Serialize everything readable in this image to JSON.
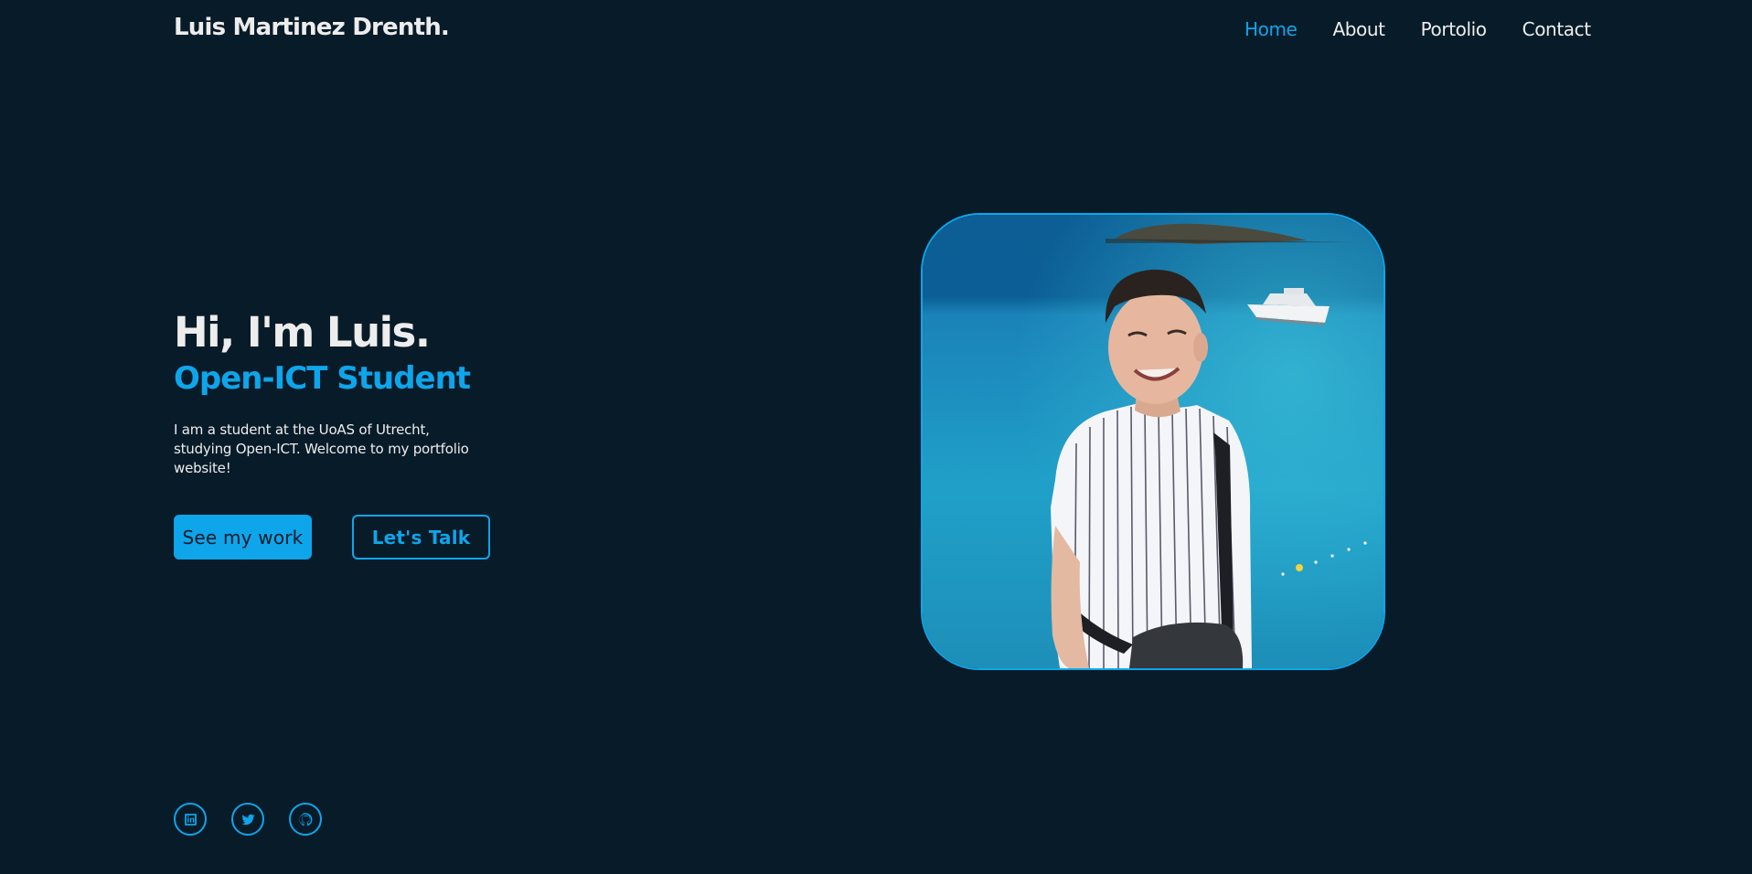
{
  "header": {
    "logo": "Luis Martinez Drenth.",
    "nav": [
      {
        "label": "Home",
        "active": true
      },
      {
        "label": "About",
        "active": false
      },
      {
        "label": "Portolio",
        "active": false
      },
      {
        "label": "Contact",
        "active": false
      }
    ]
  },
  "hero": {
    "greeting": "Hi, I'm Luis.",
    "role": "Open-ICT Student",
    "intro": "I am a student at the UoAS of Utrecht, studying Open-ICT. Welcome to my portfolio website!",
    "primary_button": "See my work",
    "secondary_button": "Let's Talk"
  },
  "social": [
    {
      "icon": "linkedin-icon"
    },
    {
      "icon": "twitter-icon"
    },
    {
      "icon": "github-icon"
    }
  ],
  "colors": {
    "background": "#081b29",
    "accent": "#0ea5ea",
    "text": "#ededed"
  }
}
